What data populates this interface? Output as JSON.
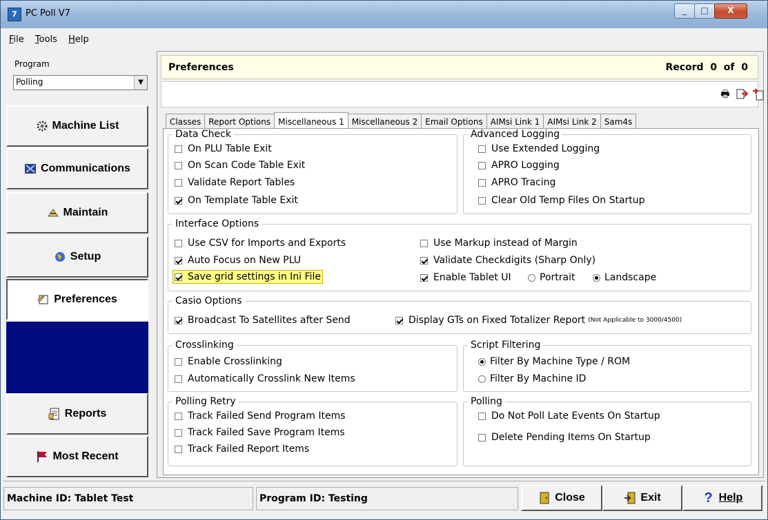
{
  "window": {
    "title": "PC Poll V7",
    "controls": [
      "_",
      "□",
      "X"
    ]
  },
  "menu": [
    {
      "label": "File",
      "hotkey": "F",
      "rest": "ile"
    },
    {
      "label": "Tools",
      "hotkey": "T",
      "rest": "ools"
    },
    {
      "label": "Help",
      "hotkey": "H",
      "rest": "elp"
    }
  ],
  "sidebar": {
    "program_label": "Program",
    "program_value": "Polling",
    "nav": [
      {
        "label": "Machine List",
        "icon": "gear-icon"
      },
      {
        "label": "Communications",
        "icon": "communications-icon"
      },
      {
        "label": "Maintain",
        "icon": "maintain-icon"
      },
      {
        "label": "Setup",
        "icon": "globe-icon"
      },
      {
        "label": "Preferences",
        "icon": "preferences-icon",
        "active": true
      },
      {
        "label": "Reports",
        "icon": "reports-icon"
      },
      {
        "label": "Most Recent",
        "icon": "flag-icon"
      }
    ]
  },
  "header": {
    "title": "Preferences",
    "record": "Record  0  of  0"
  },
  "tabs": [
    "Classes",
    "Report Options",
    "Miscellaneous 1",
    "Miscellaneous 2",
    "Email Options",
    "AIMsi Link 1",
    "AIMsi Link 2",
    "Sam4s"
  ],
  "active_tab": "Miscellaneous 1",
  "groups": {
    "data_check": {
      "title": "Data Check",
      "items": [
        {
          "label": "On PLU Table Exit",
          "checked": false
        },
        {
          "label": "On Scan Code Table Exit",
          "checked": false
        },
        {
          "label": "Validate Report Tables",
          "checked": false
        },
        {
          "label": "On Template Table Exit",
          "checked": true
        }
      ]
    },
    "advanced_logging": {
      "title": "Advanced Logging",
      "items": [
        {
          "label": "Use Extended Logging",
          "checked": false
        },
        {
          "label": "APRO Logging",
          "checked": false
        },
        {
          "label": "APRO Tracing",
          "checked": false
        },
        {
          "label": "Clear Old Temp Files On Startup",
          "checked": false
        }
      ]
    },
    "interface_options": {
      "title": "Interface Options",
      "left": [
        {
          "label": "Use CSV for Imports and Exports",
          "checked": false
        },
        {
          "label": "Auto Focus on New PLU",
          "checked": true
        },
        {
          "label": "Save grid settings in Ini File",
          "checked": true,
          "highlighted": true
        }
      ],
      "right": [
        {
          "label": "Use Markup instead of Margin",
          "checked": false
        },
        {
          "label": "Validate Checkdigits (Sharp Only)",
          "checked": true
        },
        {
          "label": "Enable Tablet UI",
          "checked": true
        }
      ],
      "orientation": {
        "options": [
          "Portrait",
          "Landscape"
        ],
        "selected": "Landscape"
      }
    },
    "casio_options": {
      "title": "Casio Options",
      "items": [
        {
          "label": "Broadcast To Satellites after Send",
          "checked": true
        },
        {
          "label": "Display GTs on Fixed Totalizer Report",
          "checked": true,
          "note": "(Not Applicable to 3000/4500)"
        }
      ]
    },
    "crosslinking": {
      "title": "Crosslinking",
      "items": [
        {
          "label": "Enable Crosslinking",
          "checked": false
        },
        {
          "label": "Automatically Crosslink New Items",
          "checked": false
        }
      ]
    },
    "script_filtering": {
      "title": "Script Filtering",
      "items": [
        {
          "label": "Filter By Machine Type / ROM",
          "selected": true
        },
        {
          "label": "Filter By Machine ID",
          "selected": false
        }
      ]
    },
    "polling_retry": {
      "title": "Polling Retry",
      "items": [
        {
          "label": "Track Failed Send Program Items",
          "checked": false
        },
        {
          "label": "Track Failed Save Program Items",
          "checked": false
        },
        {
          "label": "Track Failed Report Items",
          "checked": false
        }
      ]
    },
    "polling": {
      "title": "Polling",
      "items": [
        {
          "label": "Do Not Poll Late Events On Startup",
          "checked": false
        },
        {
          "label": "Delete Pending Items On Startup",
          "checked": false
        }
      ]
    }
  },
  "status": {
    "machine": "Machine ID: Tablet Test",
    "program": "Program ID: Testing",
    "buttons": {
      "close": "Close",
      "exit": "Exit",
      "help": "Help"
    }
  },
  "colors": {
    "nav_fill": "#000c80",
    "highlight": "#ffff88",
    "header_bg": "#ffffe8"
  }
}
